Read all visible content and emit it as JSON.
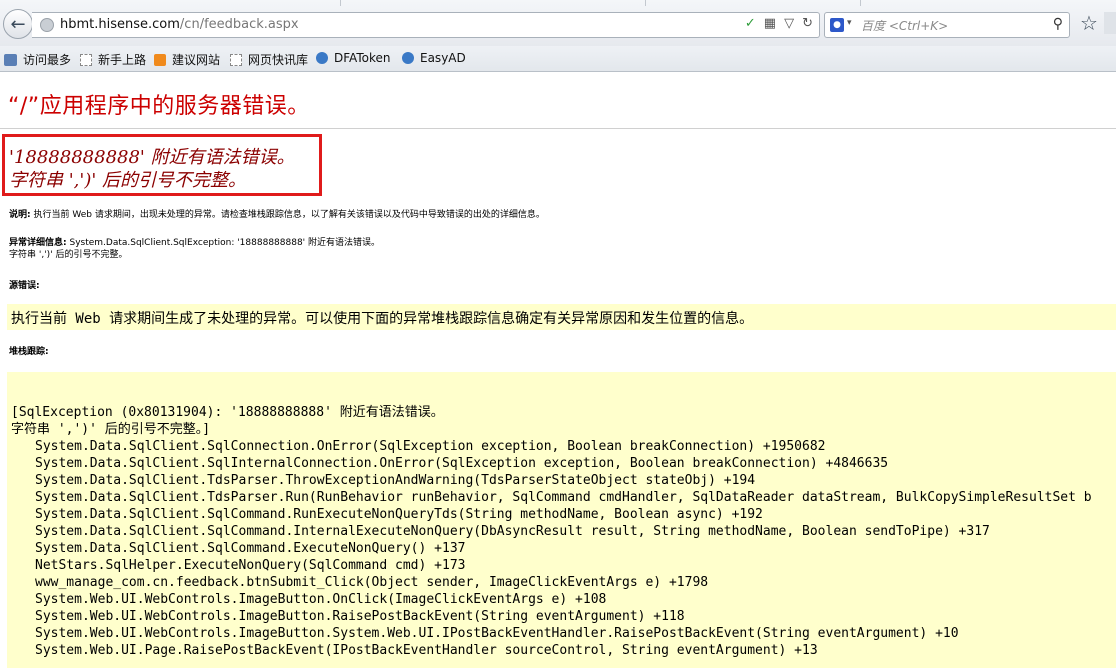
{
  "browser": {
    "url_host": "hbmt.hisense.com",
    "url_path": "/cn/feedback.aspx",
    "search_placeholder": "百度 <Ctrl+K>",
    "bookmarks": [
      "访问最多",
      "新手上路",
      "建议网站",
      "网页快讯库",
      "DFAToken",
      "EasyAD"
    ]
  },
  "page": {
    "title": "“/”应用程序中的服务器错误。",
    "error_message_line1": "'18888888888' 附近有语法错误。",
    "error_message_line2": "字符串 ',')' 后的引号不完整。",
    "description_label": "说明:",
    "description_text": "执行当前 Web 请求期间，出现未处理的异常。请检查堆栈跟踪信息，以了解有关该错误以及代码中导致错误的出处的详细信息。",
    "exception_label": "异常详细信息:",
    "exception_text": "System.Data.SqlClient.SqlException: '18888888888' 附近有语法错误。",
    "exception_text2": "字符串 ',')' 后的引号不完整。",
    "source_error_label": "源错误:",
    "source_error_text": "执行当前 Web 请求期间生成了未处理的异常。可以使用下面的异常堆栈跟踪信息确定有关异常原因和发生位置的信息。",
    "stack_trace_label": "堆栈跟踪:",
    "stack_header1": "[SqlException (0x80131904): '18888888888' 附近有语法错误。",
    "stack_header2": "字符串 ',')' 后的引号不完整。]",
    "stack_lines": [
      "System.Data.SqlClient.SqlConnection.OnError(SqlException exception, Boolean breakConnection) +1950682",
      "System.Data.SqlClient.SqlInternalConnection.OnError(SqlException exception, Boolean breakConnection) +4846635",
      "System.Data.SqlClient.TdsParser.ThrowExceptionAndWarning(TdsParserStateObject stateObj) +194",
      "System.Data.SqlClient.TdsParser.Run(RunBehavior runBehavior, SqlCommand cmdHandler, SqlDataReader dataStream, BulkCopySimpleResultSet b",
      "System.Data.SqlClient.SqlCommand.RunExecuteNonQueryTds(String methodName, Boolean async) +192",
      "System.Data.SqlClient.SqlCommand.InternalExecuteNonQuery(DbAsyncResult result, String methodName, Boolean sendToPipe) +317",
      "System.Data.SqlClient.SqlCommand.ExecuteNonQuery() +137",
      "NetStars.SqlHelper.ExecuteNonQuery(SqlCommand cmd) +173",
      "www_manage_com.cn.feedback.btnSubmit_Click(Object sender, ImageClickEventArgs e) +1798",
      "System.Web.UI.WebControls.ImageButton.OnClick(ImageClickEventArgs e) +108",
      "System.Web.UI.WebControls.ImageButton.RaisePostBackEvent(String eventArgument) +118",
      "System.Web.UI.WebControls.ImageButton.System.Web.UI.IPostBackEventHandler.RaisePostBackEvent(String eventArgument) +10",
      "System.Web.UI.Page.RaisePostBackEvent(IPostBackEventHandler sourceControl, String eventArgument) +13"
    ]
  }
}
